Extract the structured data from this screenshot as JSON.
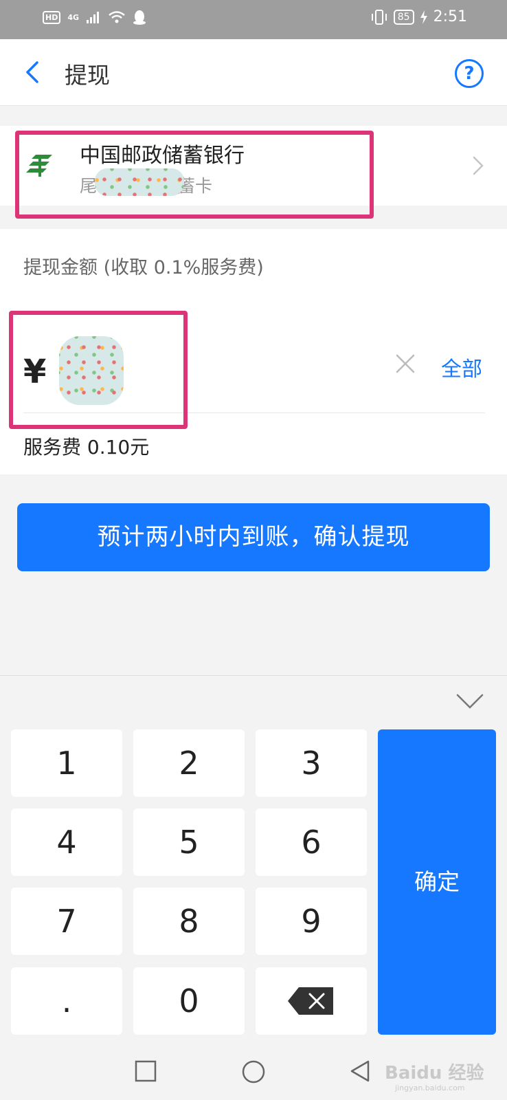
{
  "status_bar": {
    "hd": "HD",
    "network": "4G",
    "battery": "85",
    "time": "2:51"
  },
  "header": {
    "title": "提现",
    "help_icon": "?"
  },
  "bank": {
    "name": "中国邮政储蓄银行",
    "sub_prefix": "尾",
    "sub_suffix": "蓄卡"
  },
  "amount": {
    "label": "提现金额 (收取 0.1%服务费)",
    "currency": "¥",
    "all_label": "全部",
    "fee_text": "服务费 0.10元"
  },
  "confirm_button": "预计两小时内到账，确认提现",
  "keypad": {
    "keys": [
      "1",
      "2",
      "3",
      "4",
      "5",
      "6",
      "7",
      "8",
      "9",
      ".",
      "0"
    ],
    "confirm": "确定"
  },
  "watermark": {
    "brand": "Baidu 经验",
    "url": "jingyan.baidu.com"
  },
  "colors": {
    "accent": "#1677ff",
    "highlight": "#dd3377"
  }
}
